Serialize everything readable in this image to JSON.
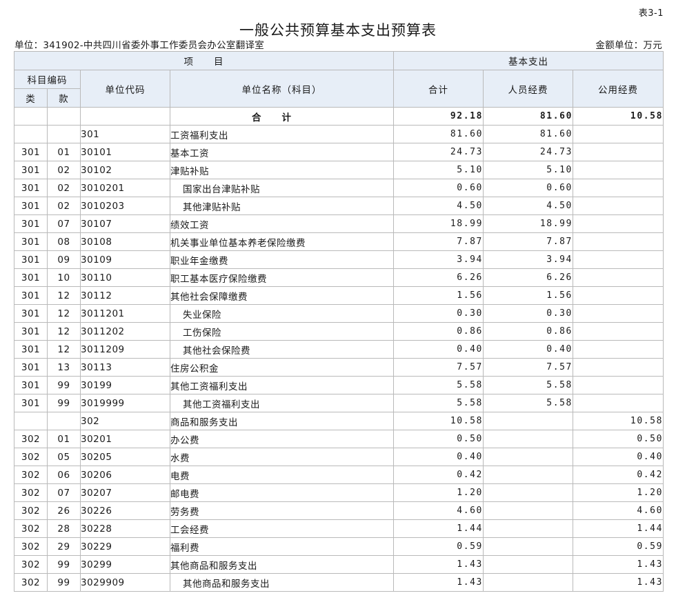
{
  "header": {
    "table_no": "表3-1",
    "title": "一般公共预算基本支出预算表",
    "unit_left": "单位：341902-中共四川省委外事工作委员会办公室翻译室",
    "unit_right": "金额单位：万元"
  },
  "columns": {
    "project": "项　　目",
    "basic_expense": "基本支出",
    "subject_code": "科目编码",
    "lei": "类",
    "kuan": "款",
    "unit_code": "单位代码",
    "unit_name": "单位名称（科目）",
    "total": "合计",
    "personnel": "人员经费",
    "public": "公用经费"
  },
  "total_row": {
    "label": "合计",
    "total": "92.18",
    "personnel": "81.60",
    "public": "10.58"
  },
  "rows": [
    {
      "lei": "",
      "kuan": "",
      "code": "301",
      "name": "工资福利支出",
      "indent": false,
      "total": "81.60",
      "personnel": "81.60",
      "public": ""
    },
    {
      "lei": "301",
      "kuan": "01",
      "code": "30101",
      "name": "基本工资",
      "indent": false,
      "total": "24.73",
      "personnel": "24.73",
      "public": ""
    },
    {
      "lei": "301",
      "kuan": "02",
      "code": "30102",
      "name": "津贴补贴",
      "indent": false,
      "total": "5.10",
      "personnel": "5.10",
      "public": ""
    },
    {
      "lei": "301",
      "kuan": "02",
      "code": "3010201",
      "name": "国家出台津贴补贴",
      "indent": true,
      "total": "0.60",
      "personnel": "0.60",
      "public": ""
    },
    {
      "lei": "301",
      "kuan": "02",
      "code": "3010203",
      "name": "其他津贴补贴",
      "indent": true,
      "total": "4.50",
      "personnel": "4.50",
      "public": ""
    },
    {
      "lei": "301",
      "kuan": "07",
      "code": "30107",
      "name": "绩效工资",
      "indent": false,
      "total": "18.99",
      "personnel": "18.99",
      "public": ""
    },
    {
      "lei": "301",
      "kuan": "08",
      "code": "30108",
      "name": "机关事业单位基本养老保险缴费",
      "indent": false,
      "total": "7.87",
      "personnel": "7.87",
      "public": ""
    },
    {
      "lei": "301",
      "kuan": "09",
      "code": "30109",
      "name": "职业年金缴费",
      "indent": false,
      "total": "3.94",
      "personnel": "3.94",
      "public": ""
    },
    {
      "lei": "301",
      "kuan": "10",
      "code": "30110",
      "name": "职工基本医疗保险缴费",
      "indent": false,
      "total": "6.26",
      "personnel": "6.26",
      "public": ""
    },
    {
      "lei": "301",
      "kuan": "12",
      "code": "30112",
      "name": "其他社会保障缴费",
      "indent": false,
      "total": "1.56",
      "personnel": "1.56",
      "public": ""
    },
    {
      "lei": "301",
      "kuan": "12",
      "code": "3011201",
      "name": "失业保险",
      "indent": true,
      "total": "0.30",
      "personnel": "0.30",
      "public": ""
    },
    {
      "lei": "301",
      "kuan": "12",
      "code": "3011202",
      "name": "工伤保险",
      "indent": true,
      "total": "0.86",
      "personnel": "0.86",
      "public": ""
    },
    {
      "lei": "301",
      "kuan": "12",
      "code": "3011209",
      "name": "其他社会保险费",
      "indent": true,
      "total": "0.40",
      "personnel": "0.40",
      "public": ""
    },
    {
      "lei": "301",
      "kuan": "13",
      "code": "30113",
      "name": "住房公积金",
      "indent": false,
      "total": "7.57",
      "personnel": "7.57",
      "public": ""
    },
    {
      "lei": "301",
      "kuan": "99",
      "code": "30199",
      "name": "其他工资福利支出",
      "indent": false,
      "total": "5.58",
      "personnel": "5.58",
      "public": ""
    },
    {
      "lei": "301",
      "kuan": "99",
      "code": "3019999",
      "name": "其他工资福利支出",
      "indent": true,
      "total": "5.58",
      "personnel": "5.58",
      "public": ""
    },
    {
      "lei": "",
      "kuan": "",
      "code": "302",
      "name": "商品和服务支出",
      "indent": false,
      "total": "10.58",
      "personnel": "",
      "public": "10.58"
    },
    {
      "lei": "302",
      "kuan": "01",
      "code": "30201",
      "name": "办公费",
      "indent": false,
      "total": "0.50",
      "personnel": "",
      "public": "0.50"
    },
    {
      "lei": "302",
      "kuan": "05",
      "code": "30205",
      "name": "水费",
      "indent": false,
      "total": "0.40",
      "personnel": "",
      "public": "0.40"
    },
    {
      "lei": "302",
      "kuan": "06",
      "code": "30206",
      "name": "电费",
      "indent": false,
      "total": "0.42",
      "personnel": "",
      "public": "0.42"
    },
    {
      "lei": "302",
      "kuan": "07",
      "code": "30207",
      "name": "邮电费",
      "indent": false,
      "total": "1.20",
      "personnel": "",
      "public": "1.20"
    },
    {
      "lei": "302",
      "kuan": "26",
      "code": "30226",
      "name": "劳务费",
      "indent": false,
      "total": "4.60",
      "personnel": "",
      "public": "4.60"
    },
    {
      "lei": "302",
      "kuan": "28",
      "code": "30228",
      "name": "工会经费",
      "indent": false,
      "total": "1.44",
      "personnel": "",
      "public": "1.44"
    },
    {
      "lei": "302",
      "kuan": "29",
      "code": "30229",
      "name": "福利费",
      "indent": false,
      "total": "0.59",
      "personnel": "",
      "public": "0.59"
    },
    {
      "lei": "302",
      "kuan": "99",
      "code": "30299",
      "name": "其他商品和服务支出",
      "indent": false,
      "total": "1.43",
      "personnel": "",
      "public": "1.43"
    },
    {
      "lei": "302",
      "kuan": "99",
      "code": "3029909",
      "name": "其他商品和服务支出",
      "indent": true,
      "total": "1.43",
      "personnel": "",
      "public": "1.43"
    }
  ]
}
